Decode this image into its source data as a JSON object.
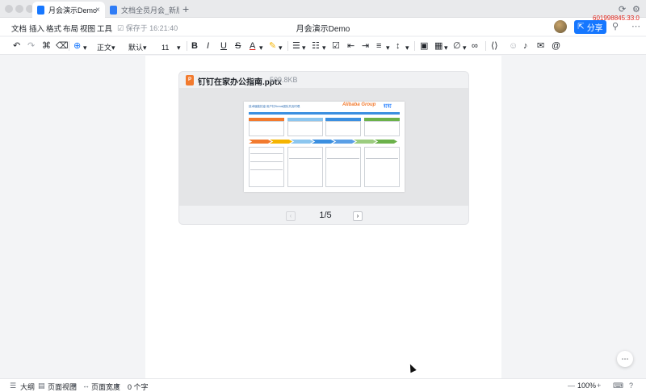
{
  "tabs": [
    {
      "label": "月会演示Demo",
      "active": true
    },
    {
      "label": "文档全员月会_新版",
      "active": false
    }
  ],
  "header": {
    "menus": [
      "文档",
      "插入",
      "格式",
      "布局",
      "视图",
      "工具"
    ],
    "saved_text": "保存于 16:21:40",
    "doc_title": "月会演示Demo",
    "share_label": "分享",
    "overlay_text": "601998845.33.0"
  },
  "toolbar": {
    "style_label": "正文",
    "font_label": "默认",
    "size_label": "11",
    "bold": "B",
    "italic": "I",
    "underline": "U",
    "strike": "S",
    "font_color": "A",
    "at_symbol": "@"
  },
  "attachment": {
    "name": "钉钉在家办公指南.pptx",
    "size": "509.8KB",
    "icon_label": "P",
    "page_text": "1/5",
    "slide": {
      "title": "技术赋能抗疫 用户钉Bonus团队共克时艰",
      "logo": "Alibaba Group",
      "logo2": "钉钉"
    }
  },
  "statusbar": {
    "outline_label": "大纲",
    "view_label": "页面视图",
    "width_label": "页面宽度",
    "word_count": "0 个字",
    "zoom": "100%"
  },
  "colors": {
    "accent": "#1677ff",
    "ppt_orange": "#f27a2e",
    "overlay_red": "#e0251b"
  }
}
